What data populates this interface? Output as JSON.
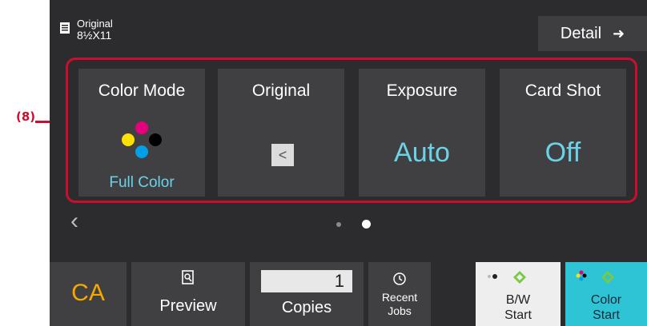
{
  "callout": {
    "label": "(8)"
  },
  "top_bar": {
    "original_label": "Original",
    "original_size": "8½X11",
    "detail_label": "Detail",
    "detail_arrow": "➜"
  },
  "cards": [
    {
      "title": "Color Mode",
      "value": "",
      "sub": "Full Color",
      "icon": "color-dots-icon"
    },
    {
      "title": "Original",
      "value": "",
      "sub": "",
      "icon": "orientation-icon",
      "icon_glyph": "<"
    },
    {
      "title": "Exposure",
      "value": "Auto",
      "sub": ""
    },
    {
      "title": "Card Shot",
      "value": "Off",
      "sub": ""
    }
  ],
  "nav": {
    "prev_arrow": "‹",
    "pages": 2,
    "current_page": 2
  },
  "bottom": {
    "ca": "CA",
    "preview": "Preview",
    "copies_value": "1",
    "copies_label": "Copies",
    "recent_line1": "Recent",
    "recent_line2": "Jobs",
    "bw_line1": "B/W",
    "bw_line2": "Start",
    "color_line1": "Color",
    "color_line2": "Start"
  },
  "colors": {
    "accent_red": "#c8102e",
    "value_cyan": "#6ad3e8",
    "ca_orange": "#f5a800",
    "start_green": "#7ac943",
    "color_start_bg": "#2ec4d6"
  }
}
